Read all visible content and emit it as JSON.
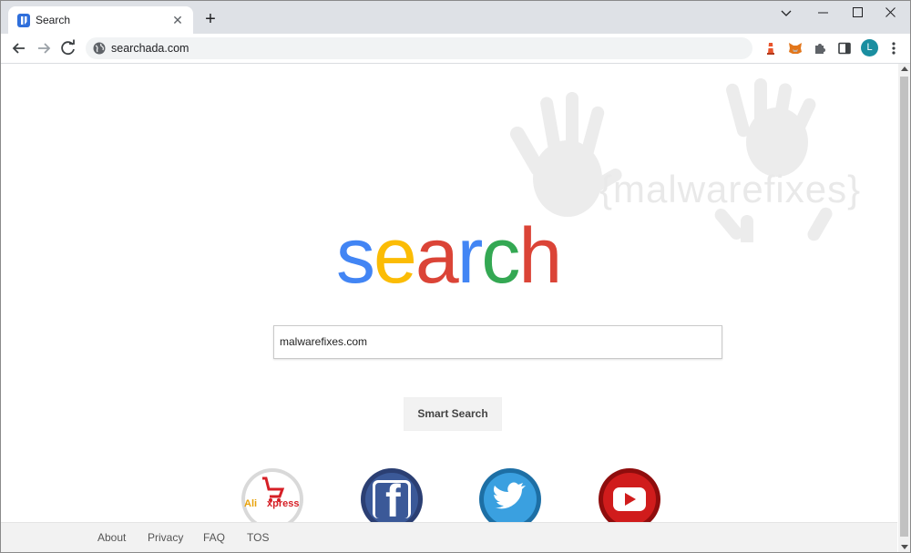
{
  "browser": {
    "tab_title": "Search",
    "url": "searchada.com",
    "profile_initial": "L"
  },
  "page": {
    "watermark": "{malwarefixes}",
    "logo_letters": [
      {
        "char": "s",
        "color": "#4285f4"
      },
      {
        "char": "e",
        "color": "#fbbc05"
      },
      {
        "char": "a",
        "color": "#db4437"
      },
      {
        "char": "r",
        "color": "#4285f4"
      },
      {
        "char": "c",
        "color": "#34a853"
      },
      {
        "char": "h",
        "color": "#db4437"
      }
    ],
    "search_value": "malwarefixes.com",
    "search_button": "Smart Search",
    "shortcuts": [
      {
        "name": "aliexpress",
        "label_a": "Ali",
        "label_b": "xpress"
      },
      {
        "name": "facebook",
        "label": "f"
      },
      {
        "name": "twitter"
      },
      {
        "name": "youtube"
      }
    ]
  },
  "footer": {
    "links": [
      "About",
      "Privacy",
      "FAQ",
      "TOS"
    ]
  }
}
